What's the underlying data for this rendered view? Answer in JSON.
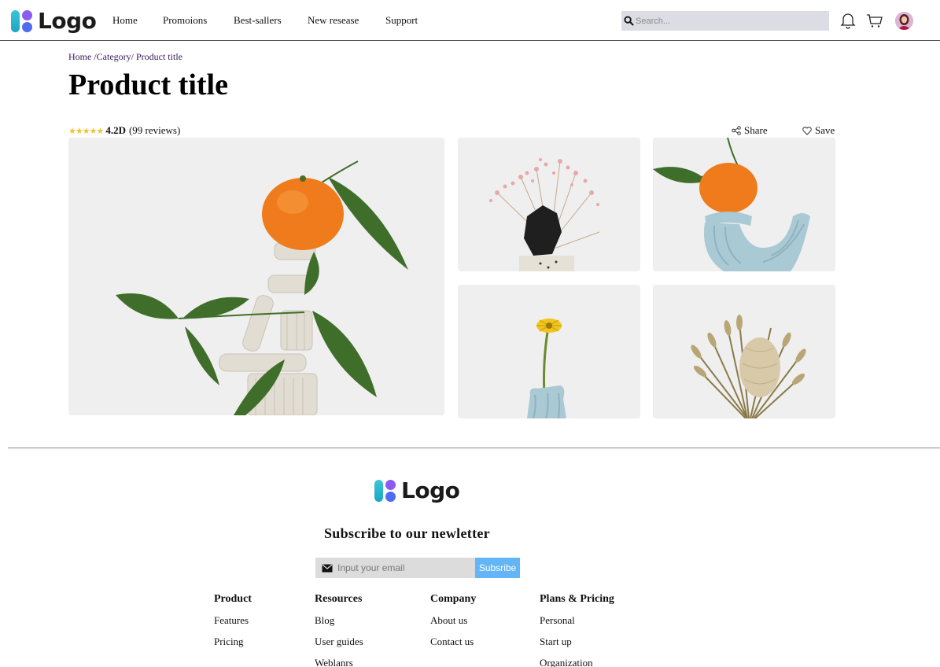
{
  "header": {
    "logo_text": "Logo",
    "nav": [
      {
        "label": "Home"
      },
      {
        "label": "Promoions"
      },
      {
        "label": "Best-sallers"
      },
      {
        "label": "New resease"
      },
      {
        "label": "Support"
      }
    ],
    "search_placeholder": "Search..."
  },
  "breadcrumb": "Home /Category/ Product title",
  "product": {
    "title": "Product title",
    "rating_value": "4.2D",
    "review_count": "(99 reviews)",
    "stars": 4.5,
    "share_label": "Share",
    "save_label": "Save"
  },
  "footer": {
    "logo_text": "Logo",
    "subscribe_title": "Subscribe to our newletter",
    "email_placeholder": "Input your email",
    "subscribe_button": "Subsribe",
    "columns": [
      {
        "title": "Product",
        "items": [
          "Features",
          "Pricing"
        ]
      },
      {
        "title": "Resources",
        "items": [
          "Blog",
          "User guides",
          "Weblanrs"
        ]
      },
      {
        "title": "Company",
        "items": [
          "About us",
          "Contact us"
        ]
      },
      {
        "title": "Plans & Pricing",
        "items": [
          "Personal",
          "Start up",
          "Organization"
        ]
      }
    ]
  },
  "colors": {
    "star": "#f2c232",
    "subscribe_button": "#64b5f6",
    "search_bg": "#dcdce4"
  }
}
